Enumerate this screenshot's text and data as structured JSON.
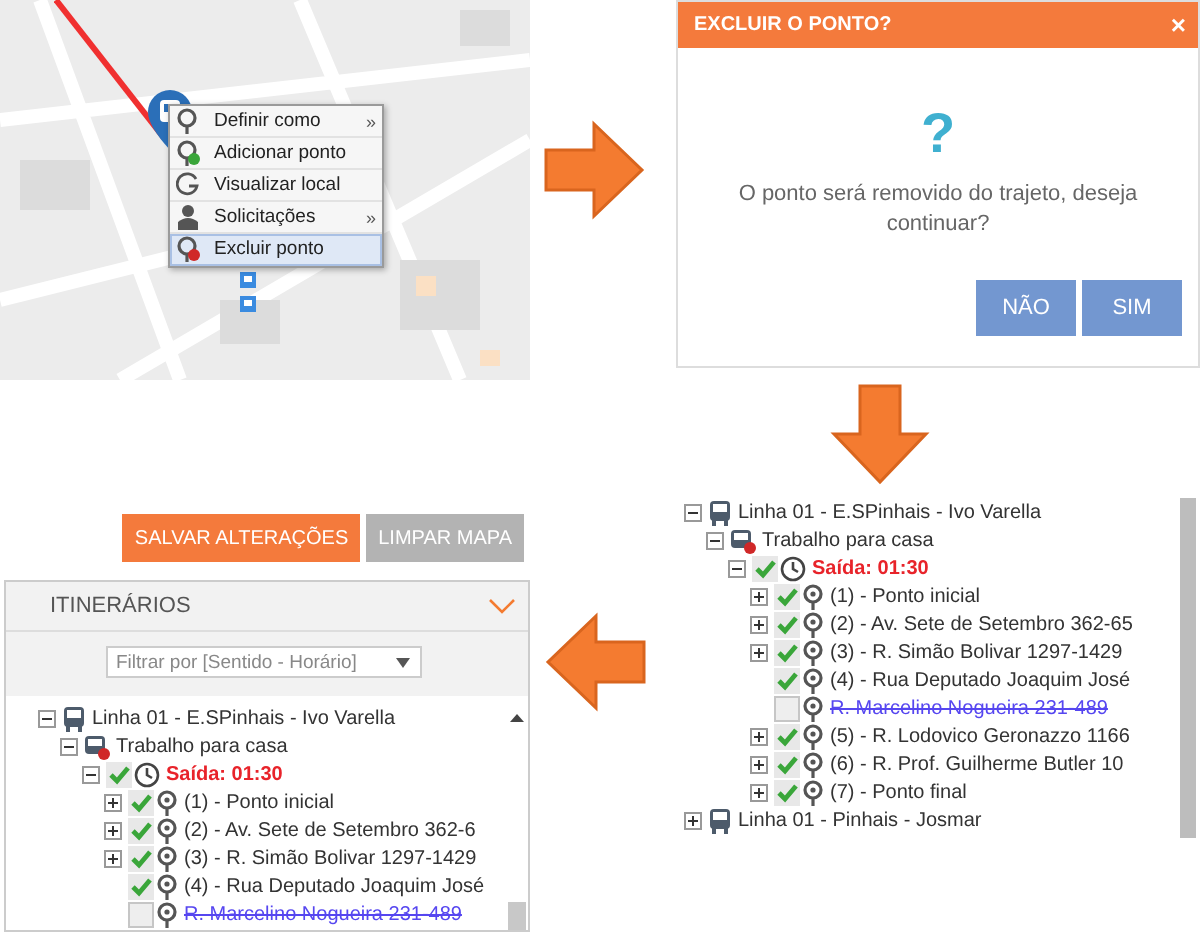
{
  "map_panel": {
    "kind": "picture",
    "context_menu": [
      {
        "label": "Definir como",
        "kind": "pin",
        "submenu": "»",
        "selected": false
      },
      {
        "label": "Adicionar ponto",
        "kind": "pin-add",
        "selected": false
      },
      {
        "label": "Visualizar local",
        "kind": "google",
        "selected": false
      },
      {
        "label": "Solicitações",
        "kind": "person",
        "submenu": "»",
        "selected": false
      },
      {
        "label": "Excluir ponto",
        "kind": "pin-remove",
        "selected": true
      }
    ]
  },
  "dialog": {
    "title": "EXCLUIR O PONTO?",
    "close": "×",
    "icon": "?",
    "message": "O ponto será removido do trajeto, deseja continuar?",
    "buttons": [
      "NÃO",
      "SIM"
    ]
  },
  "tree_panel": {
    "nodes": [
      {
        "kind": "line",
        "label": "Linha 01 - E.SPinhais - Ivo Varella",
        "expanded": true,
        "children": [
          {
            "kind": "trip",
            "label": "Trabalho para casa",
            "expanded": true,
            "children": [
              {
                "kind": "departure",
                "label": "Saída: 01:30",
                "expanded": true,
                "checked": true,
                "children": [
                  {
                    "kind": "stop",
                    "label": "(1) - Ponto inicial",
                    "expanded": false,
                    "checked": true
                  },
                  {
                    "kind": "stop",
                    "label": "(2) - Av. Sete de Setembro 362-65",
                    "expanded": false,
                    "checked": true
                  },
                  {
                    "kind": "stop",
                    "label": "(3) - R. Simão Bolivar 1297-1429",
                    "expanded": false,
                    "checked": true
                  },
                  {
                    "kind": "stop",
                    "label": "(4) - Rua Deputado Joaquim José",
                    "checked": true
                  },
                  {
                    "kind": "removed",
                    "label": "R. Marcelino Nogueira 231-489",
                    "checked": false
                  },
                  {
                    "kind": "stop",
                    "label": "(5) - R. Lodovico Geronazzo 1166",
                    "expanded": false,
                    "checked": true
                  },
                  {
                    "kind": "stop",
                    "label": "(6) - R. Prof. Guilherme Butler 10",
                    "expanded": false,
                    "checked": true
                  },
                  {
                    "kind": "stop",
                    "label": "(7) - Ponto final",
                    "expanded": false,
                    "checked": true
                  }
                ]
              }
            ]
          }
        ]
      },
      {
        "kind": "line",
        "label": "Linha 01 - Pinhais - Josmar",
        "expanded": false
      }
    ]
  },
  "editor_panel": {
    "buttons": [
      {
        "label": "SALVAR ALTERAÇÕES",
        "kind": "primary"
      },
      {
        "label": "LIMPAR MAPA",
        "kind": "secondary"
      }
    ],
    "section_title": "ITINERÁRIOS",
    "filter": {
      "placeholder": "Filtrar por [Sentido - Horário]"
    },
    "tree": {
      "nodes": [
        {
          "kind": "line",
          "label": "Linha 01 - E.SPinhais - Ivo Varella",
          "expanded": true,
          "children": [
            {
              "kind": "trip",
              "label": "Trabalho para casa",
              "expanded": true,
              "children": [
                {
                  "kind": "departure",
                  "label": "Saída: 01:30",
                  "expanded": true,
                  "checked": true,
                  "children": [
                    {
                      "kind": "stop",
                      "label": "(1) - Ponto inicial",
                      "expanded": false,
                      "checked": true
                    },
                    {
                      "kind": "stop",
                      "label": "(2) - Av. Sete de Setembro 362-6",
                      "expanded": false,
                      "checked": true
                    },
                    {
                      "kind": "stop",
                      "label": "(3) - R. Simão Bolivar 1297-1429",
                      "expanded": false,
                      "checked": true
                    },
                    {
                      "kind": "stop",
                      "label": "(4) - Rua Deputado Joaquim José",
                      "checked": true
                    },
                    {
                      "kind": "removed",
                      "label": "R. Marcelino Nogueira 231-489",
                      "checked": false
                    }
                  ]
                }
              ]
            }
          ]
        }
      ]
    }
  }
}
